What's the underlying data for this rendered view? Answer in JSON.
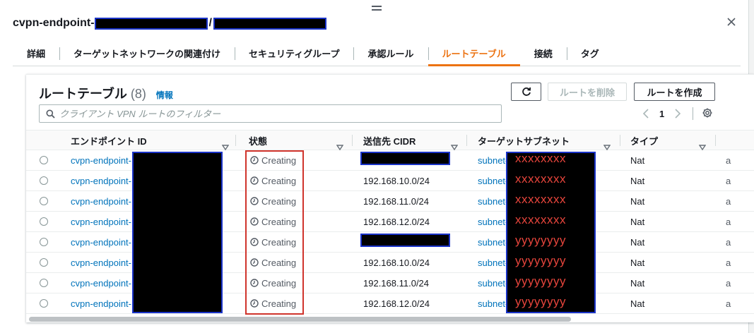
{
  "window": {
    "title_prefix": "cvpn-endpoint-",
    "title_sep": "/"
  },
  "tabs": [
    {
      "label": "詳細"
    },
    {
      "label": "ターゲットネットワークの関連付け"
    },
    {
      "label": "セキュリティグループ"
    },
    {
      "label": "承認ルール"
    },
    {
      "label": "ルートテーブル"
    },
    {
      "label": "接続"
    },
    {
      "label": "タグ"
    }
  ],
  "active_tab": "ルートテーブル",
  "card": {
    "title": "ルートテーブル",
    "count": "(8)",
    "info_link": "情報",
    "delete_button": "ルートを削除",
    "create_button": "ルートを作成",
    "search_placeholder": "クライアント VPN ルートのフィルター",
    "page": "1"
  },
  "table": {
    "columns": [
      "エンドポイント ID",
      "状態",
      "送信先 CIDR",
      "ターゲットサブネット",
      "タイプ"
    ],
    "rows": [
      {
        "endpoint": "cvpn-endpoint-",
        "status": "Creating",
        "cidr": "",
        "subnet": "subnet-",
        "subnet_mask": "xxxxxxxx",
        "type": "Nat"
      },
      {
        "endpoint": "cvpn-endpoint-",
        "status": "Creating",
        "cidr": "192.168.10.0/24",
        "subnet": "subnet-",
        "subnet_mask": "xxxxxxxx",
        "type": "Nat"
      },
      {
        "endpoint": "cvpn-endpoint-",
        "status": "Creating",
        "cidr": "192.168.11.0/24",
        "subnet": "subnet-",
        "subnet_mask": "xxxxxxxx",
        "type": "Nat"
      },
      {
        "endpoint": "cvpn-endpoint-",
        "status": "Creating",
        "cidr": "192.168.12.0/24",
        "subnet": "subnet-",
        "subnet_mask": "xxxxxxxx",
        "type": "Nat"
      },
      {
        "endpoint": "cvpn-endpoint-",
        "status": "Creating",
        "cidr": "",
        "subnet": "subnet-",
        "subnet_mask": "yyyyyyyy",
        "type": "Nat"
      },
      {
        "endpoint": "cvpn-endpoint-",
        "status": "Creating",
        "cidr": "192.168.10.0/24",
        "subnet": "subnet-",
        "subnet_mask": "yyyyyyyy",
        "type": "Nat"
      },
      {
        "endpoint": "cvpn-endpoint-",
        "status": "Creating",
        "cidr": "192.168.11.0/24",
        "subnet": "subnet-",
        "subnet_mask": "yyyyyyyy",
        "type": "Nat"
      },
      {
        "endpoint": "cvpn-endpoint-",
        "status": "Creating",
        "cidr": "192.168.12.0/24",
        "subnet": "subnet-",
        "subnet_mask": "yyyyyyyy",
        "type": "Nat"
      }
    ]
  },
  "colors": {
    "accent": "#ec7211",
    "link": "#0073bb",
    "highlight_box": "#d0342c",
    "redaction_border": "#1a33c8",
    "mask_text": "#e8453c"
  },
  "icons": [
    "drag-handle-icon",
    "close-icon",
    "refresh-icon",
    "search-icon",
    "chevron-left-icon",
    "chevron-right-icon",
    "gear-icon",
    "caret-down-icon",
    "clock-icon"
  ]
}
